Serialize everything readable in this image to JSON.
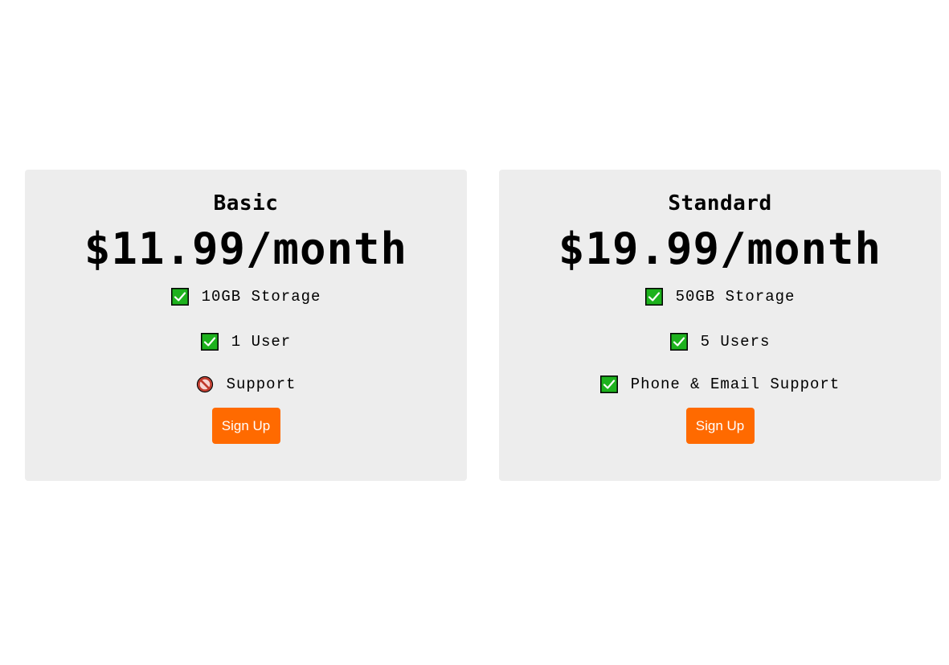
{
  "plans": [
    {
      "name": "Basic",
      "price": "$11.99/month",
      "features": [
        {
          "icon": "check-icon",
          "label": "10GB Storage"
        },
        {
          "icon": "check-icon",
          "label": "1 User"
        },
        {
          "icon": "prohibited-icon",
          "label": "Support"
        }
      ],
      "cta": "Sign Up"
    },
    {
      "name": "Standard",
      "price": "$19.99/month",
      "features": [
        {
          "icon": "check-icon",
          "label": "50GB Storage"
        },
        {
          "icon": "check-icon",
          "label": "5 Users"
        },
        {
          "icon": "check-icon",
          "label": "Phone & Email Support"
        }
      ],
      "cta": "Sign Up"
    }
  ],
  "colors": {
    "card_background": "#ededed",
    "cta_background": "#ff6a00",
    "cta_text": "#ffffff",
    "check_green": "#1db21d",
    "prohibited_red": "#c0392b"
  }
}
